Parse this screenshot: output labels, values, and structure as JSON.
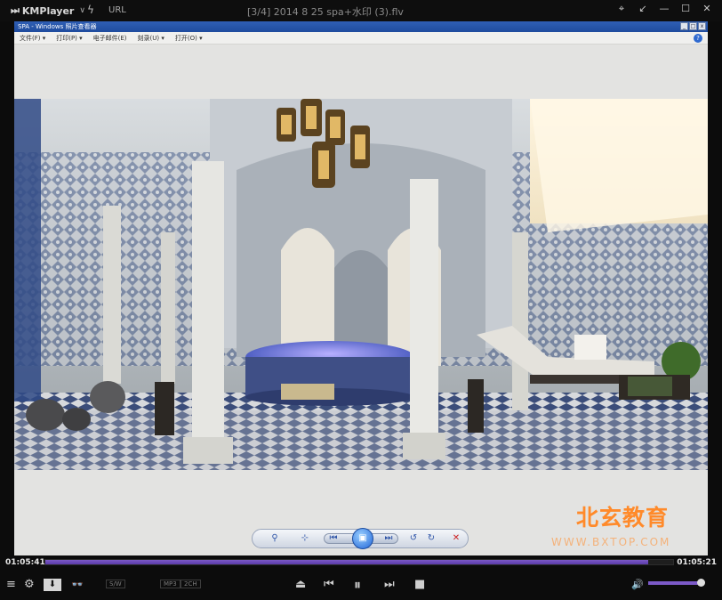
{
  "app": {
    "name": "KMPlayer",
    "url_label": "URL",
    "file_title": "[3/4] 2014 8 25 spa+水印 (3).flv"
  },
  "window_controls": [
    "pin",
    "minimize-to-corner",
    "minimize",
    "maximize",
    "close"
  ],
  "embedded_viewer": {
    "title": "SPA - Windows 照片查看器",
    "menu": [
      "文件(F) ▾",
      "打印(P) ▾",
      "电子邮件(E)",
      "刻录(U) ▾",
      "打开(O) ▾"
    ]
  },
  "watermark": {
    "chinese": "北玄教育",
    "url": "WWW.BXTOP.COM"
  },
  "playback": {
    "current_time": "01:05:41",
    "total_time": "01:05:21",
    "progress": 0.96,
    "volume": 0.92
  },
  "tags": {
    "sw": "S/W",
    "audio": "MP3",
    "channels": "2CH"
  },
  "colors": {
    "accent": "#6a4ab8",
    "watermark": "#ff8a2a"
  }
}
